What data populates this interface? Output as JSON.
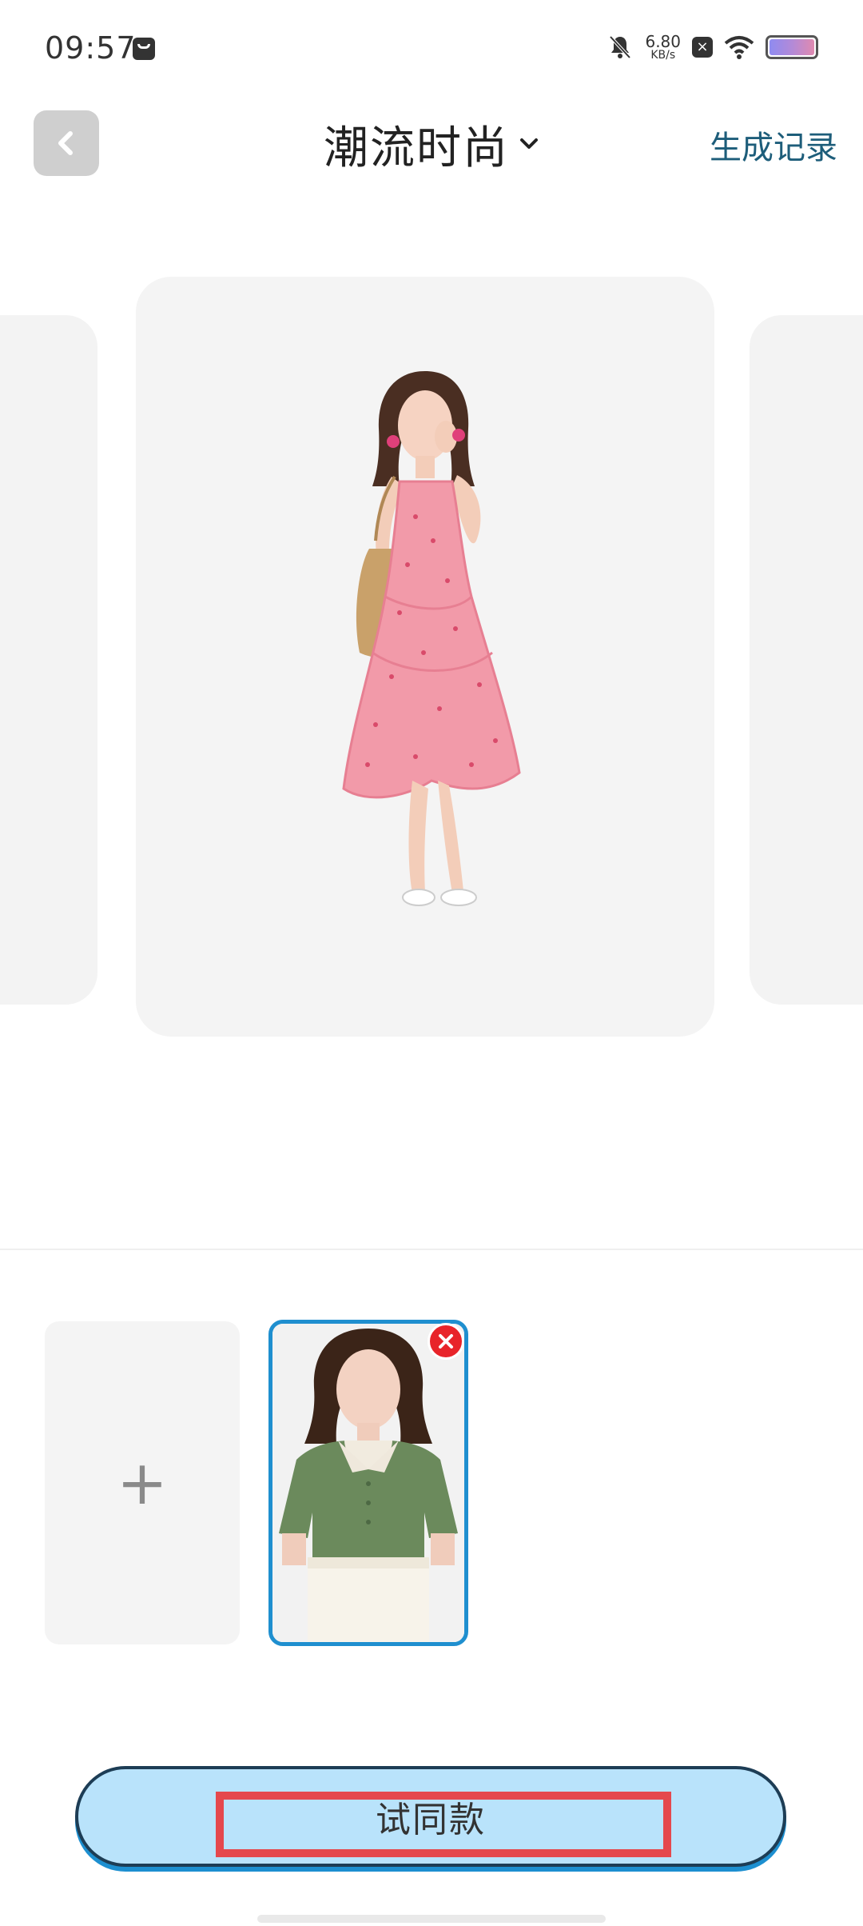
{
  "status_bar": {
    "time": "09:57",
    "net_speed_value": "6.80",
    "net_speed_unit": "KB/s",
    "battery_colors": [
      "#8f8bf0",
      "#e08ab0"
    ]
  },
  "header": {
    "title": "潮流时尚",
    "history_label": "生成记录",
    "icons": [
      "chevron-left-icon",
      "chevron-down-icon"
    ]
  },
  "carousel": {
    "items": [
      "model-photo-left",
      "model-photo-pink-floral-dress",
      "model-photo-right"
    ],
    "selected": "model-photo-pink-floral-dress"
  },
  "garments": {
    "add_label": "+",
    "items": [
      {
        "name": "green-blouse",
        "selected": true
      }
    ]
  },
  "actions": {
    "try_label": "试同款"
  },
  "colors": {
    "accent_border": "#1f8fcf",
    "button_fill": "#b9e3fb",
    "history_link": "#1d5d7a",
    "remove_badge": "#e8242a",
    "highlight_box": "#e5484d"
  }
}
